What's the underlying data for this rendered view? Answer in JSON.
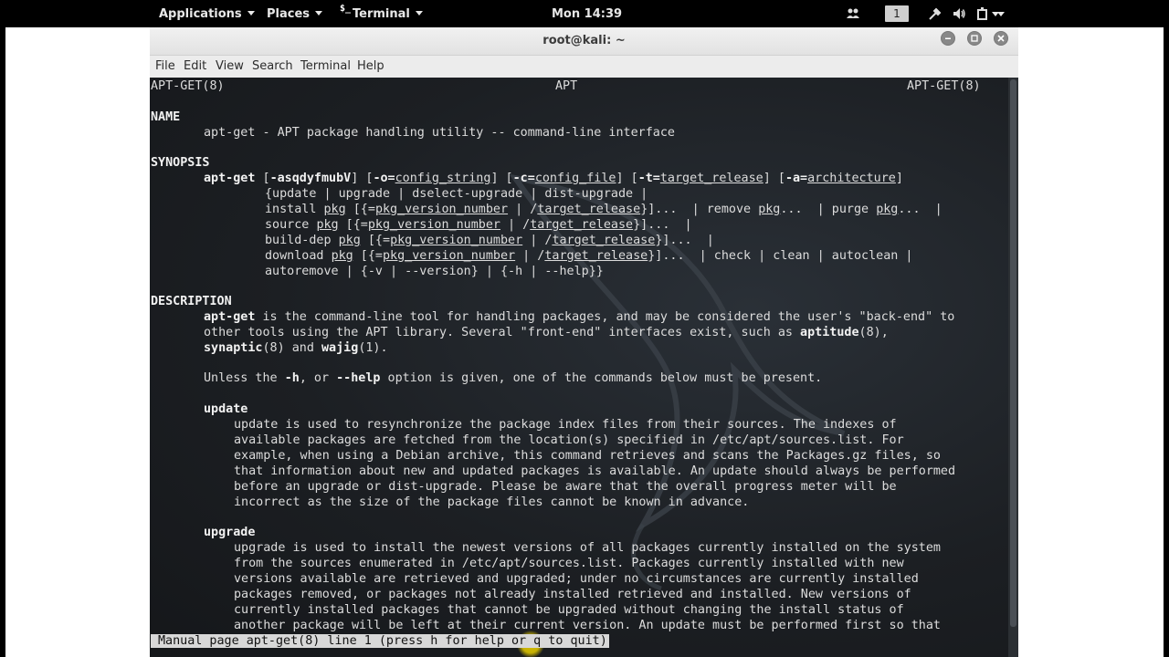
{
  "topbar": {
    "applications": "Applications",
    "places": "Places",
    "terminal_glyph": "$_",
    "terminal": "Terminal",
    "clock": "Mon 14:39",
    "workspace": "1",
    "icons": [
      "people-icon",
      "workspace-indicator",
      "settings-icon",
      "volume-icon",
      "power-icon"
    ]
  },
  "window": {
    "title": "root@kali: ~",
    "menu": [
      "File",
      "Edit",
      "View",
      "Search",
      "Terminal",
      "Help"
    ]
  },
  "man": {
    "header_left": "APT-GET(8)",
    "header_center": "APT",
    "header_right": "APT-GET(8)",
    "name_heading": "NAME",
    "name_text": "apt-get - APT package handling utility -- command-line interface",
    "synopsis_heading": "SYNOPSIS",
    "syn1": [
      "apt-get",
      " [",
      "-asqdyfmubV",
      "] [",
      "-o=",
      "config_string",
      "] [",
      "-c=",
      "config_file",
      "] [",
      "-t=",
      "target_release",
      "] [",
      "-a=",
      "architecture",
      "]"
    ],
    "syn2": "{update | upgrade | dselect-upgrade | dist-upgrade |",
    "syn3": [
      "install ",
      "pkg",
      " [{=",
      "pkg_version_number",
      " | /",
      "target_release",
      "}]...  | remove ",
      "pkg",
      "...  | purge ",
      "pkg",
      "...  |"
    ],
    "syn4": [
      "source ",
      "pkg",
      " [{=",
      "pkg_version_number",
      " | /",
      "target_release",
      "}]...  |"
    ],
    "syn5": [
      "build-dep ",
      "pkg",
      " [{=",
      "pkg_version_number",
      " | /",
      "target_release",
      "}]...  |"
    ],
    "syn6": [
      "download ",
      "pkg",
      " [{=",
      "pkg_version_number",
      " | /",
      "target_release",
      "}]...  | check | clean | autoclean |"
    ],
    "syn7": "autoremove | {-v | --version} | {-h | --help}}",
    "description_heading": "DESCRIPTION",
    "desc1": [
      "apt-get",
      " is the command-line tool for handling packages, and may be considered the user's \"back-end\" to"
    ],
    "desc2": [
      "other tools using the APT library. Several \"front-end\" interfaces exist, such as ",
      "aptitude",
      "(8),"
    ],
    "desc3": [
      "synaptic",
      "(8) and ",
      "wajig",
      "(1)."
    ],
    "desc4": [
      "Unless the ",
      "-h",
      ", or ",
      "--help",
      " option is given, one of the commands below must be present."
    ],
    "update_heading": "update",
    "update_lines": [
      "update is used to resynchronize the package index files from their sources. The indexes of",
      "available packages are fetched from the location(s) specified in /etc/apt/sources.list. For",
      "example, when using a Debian archive, this command retrieves and scans the Packages.gz files, so",
      "that information about new and updated packages is available. An update should always be performed",
      "before an upgrade or dist-upgrade. Please be aware that the overall progress meter will be",
      "incorrect as the size of the package files cannot be known in advance."
    ],
    "upgrade_heading": "upgrade",
    "upgrade_lines": [
      "upgrade is used to install the newest versions of all packages currently installed on the system",
      "from the sources enumerated in /etc/apt/sources.list. Packages currently installed with new",
      "versions available are retrieved and upgraded; under no circumstances are currently installed",
      "packages removed, or packages not already installed retrieved and installed. New versions of",
      "currently installed packages that cannot be upgraded without changing the install status of",
      "another package will be left at their current version. An update must be performed first so that"
    ],
    "status_line": "Manual page apt-get(8) line 1 (press h for help or q to quit)"
  }
}
